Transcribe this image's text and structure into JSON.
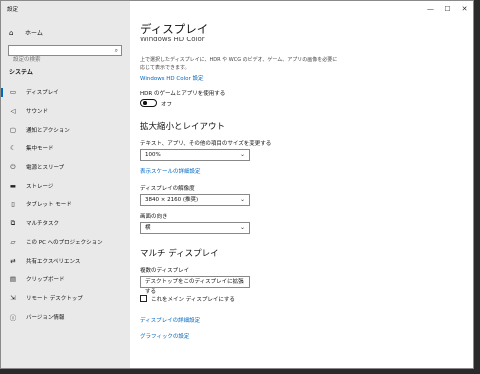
{
  "window": {
    "title": "設定",
    "controls": [
      "—",
      "☐",
      "✕"
    ]
  },
  "sidebar": {
    "home": {
      "icon": "home-icon",
      "glyph": "⌂",
      "label": "ホーム"
    },
    "search": {
      "placeholder": "設定の検索",
      "icon": "search-icon",
      "glyph": "⌕"
    },
    "section": "システム",
    "items": [
      {
        "label": "ディスプレイ",
        "icon": "monitor-icon",
        "glyph": "▭",
        "selected": true
      },
      {
        "label": "サウンド",
        "icon": "speaker-icon",
        "glyph": "◁"
      },
      {
        "label": "通知とアクション",
        "icon": "notification-icon",
        "glyph": "▢"
      },
      {
        "label": "集中モード",
        "icon": "moon-icon",
        "glyph": "☾"
      },
      {
        "label": "電源とスリープ",
        "icon": "power-icon",
        "glyph": "⏻"
      },
      {
        "label": "ストレージ",
        "icon": "storage-icon",
        "glyph": "▬"
      },
      {
        "label": "タブレット モード",
        "icon": "tablet-icon",
        "glyph": "▯"
      },
      {
        "label": "マルチタスク",
        "icon": "multitask-icon",
        "glyph": "⧉"
      },
      {
        "label": "この PC へのプロジェクション",
        "icon": "projection-icon",
        "glyph": "▱"
      },
      {
        "label": "共有エクスペリエンス",
        "icon": "share-icon",
        "glyph": "⇄"
      },
      {
        "label": "クリップボード",
        "icon": "clipboard-icon",
        "glyph": "▤"
      },
      {
        "label": "リモート デスクトップ",
        "icon": "remote-desktop-icon",
        "glyph": "⇲"
      },
      {
        "label": "バージョン情報",
        "icon": "info-icon",
        "glyph": "ⓘ"
      }
    ]
  },
  "main": {
    "title": "ディスプレイ",
    "cut_heading": "Windows HD Color",
    "hd_color_desc": "上で選択したディスプレイに、HDR や WCG のビデオ、ゲーム、アプリの画像を必要に応じて表示できます。",
    "hd_color_link": "Windows HD Color 設定",
    "hdr_label": "HDR のゲームとアプリを使用する",
    "hdr_state": "オフ",
    "scale_heading": "拡大縮小とレイアウト",
    "scale_label": "テキスト、アプリ、その他の項目のサイズを変更する",
    "scale_value": "100%",
    "scale_link": "表示スケールの詳細設定",
    "resolution_label": "ディスプレイの解像度",
    "resolution_value": "3840 × 2160 (推奨)",
    "orientation_label": "画面の向き",
    "orientation_value": "横",
    "multi_heading": "マルチ ディスプレイ",
    "multi_label": "複数のディスプレイ",
    "multi_value": "デスクトップをこのディスプレイに拡張する",
    "main_display_label": "これをメイン ディスプレイにする",
    "advanced_link": "ディスプレイの詳細設定",
    "graphics_link": "グラフィックの設定",
    "chevron": "⌄"
  }
}
